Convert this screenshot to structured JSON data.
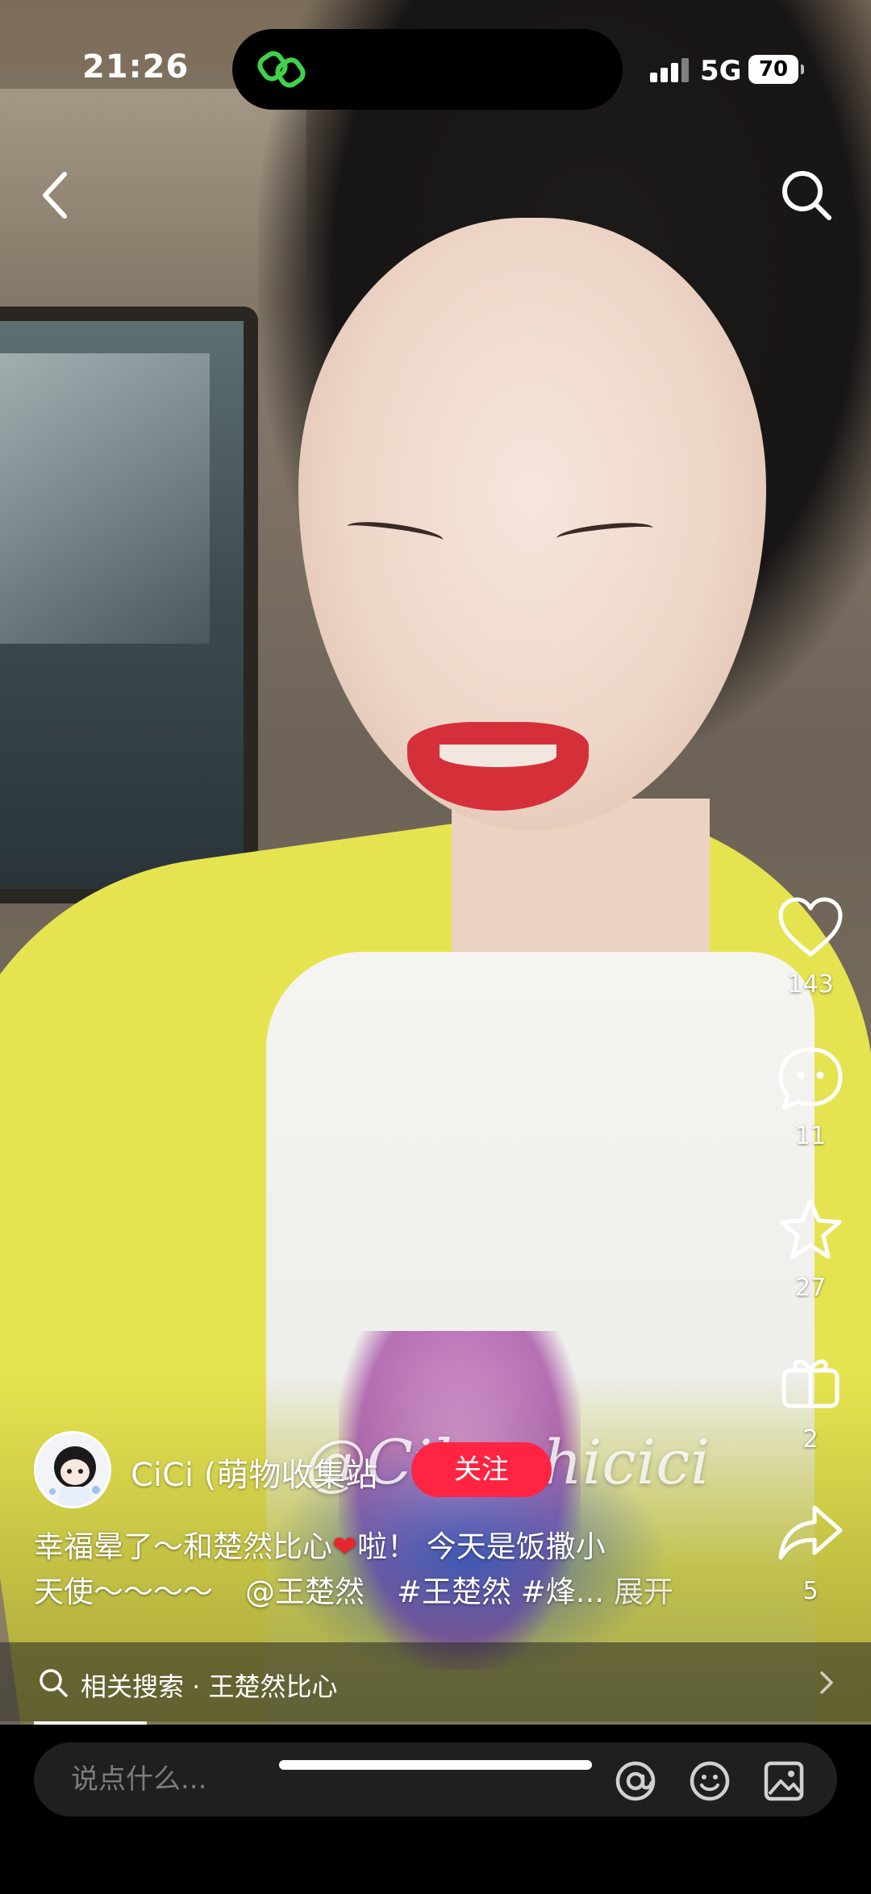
{
  "status_bar": {
    "time": "21:26",
    "network": "5G",
    "battery": "70"
  },
  "nav": {
    "back_icon": "chevron-left-icon",
    "search_icon": "search-icon"
  },
  "actions": {
    "like": {
      "icon": "heart-icon",
      "count": "143"
    },
    "comment": {
      "icon": "comment-bubble-icon",
      "count": "11"
    },
    "collect": {
      "icon": "star-icon",
      "count": "27"
    },
    "gift": {
      "icon": "gift-icon",
      "count": "2"
    },
    "share": {
      "icon": "share-icon",
      "count": "5"
    }
  },
  "author": {
    "name": "CiCi (萌物收集站",
    "follow_label": "关注",
    "watermark": "@Cibushicici"
  },
  "caption": {
    "line1_a": "幸福晕了～和楚然比心",
    "line1_b": "啦！ 今天是饭撒小",
    "line2_a": "天使～～～～",
    "mention": "@王楚然",
    "hashtags": "#王楚然 #烽...",
    "expand": "展开"
  },
  "related_search": {
    "label": "相关搜索 · 王楚然比心",
    "progress": 0.14
  },
  "comment_bar": {
    "placeholder": "说点什么...",
    "at_icon": "at-icon",
    "emoji_icon": "emoji-icon",
    "image_icon": "image-icon"
  },
  "colors": {
    "follow": "#ff2442",
    "heart": "#e8262b"
  }
}
